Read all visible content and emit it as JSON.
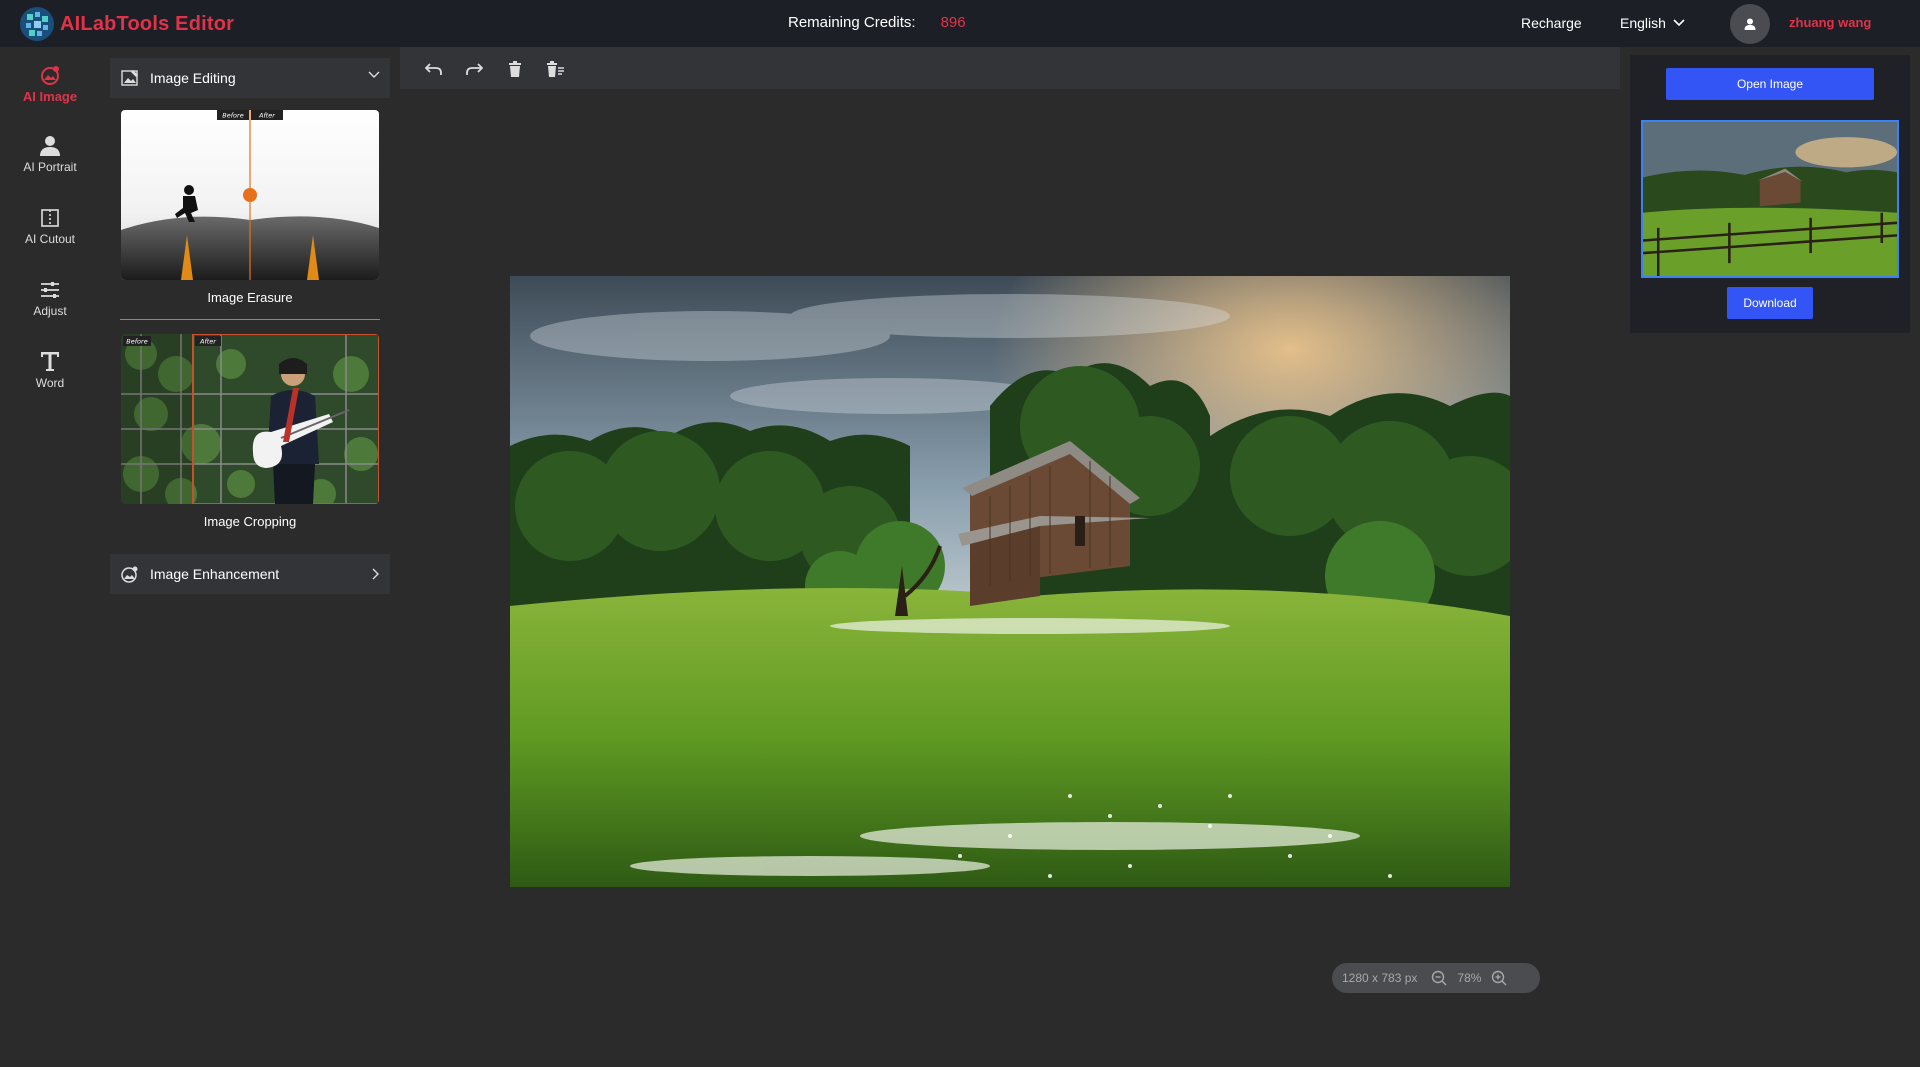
{
  "header": {
    "brand": "AILabTools Editor",
    "credits_label": "Remaining Credits:",
    "credits_value": "896",
    "recharge": "Recharge",
    "language": "English",
    "username": "zhuang wang"
  },
  "leftnav": {
    "items": [
      {
        "label": "AI Image",
        "icon": "ai-image-icon",
        "active": true
      },
      {
        "label": "AI Portrait",
        "icon": "portrait-icon"
      },
      {
        "label": "AI Cutout",
        "icon": "cutout-icon"
      },
      {
        "label": "Adjust",
        "icon": "sliders-icon"
      },
      {
        "label": "Word",
        "icon": "text-icon"
      }
    ]
  },
  "tools": {
    "section_editing": "Image Editing",
    "section_enhancement": "Image Enhancement",
    "erasure": {
      "label": "Image Erasure",
      "before": "Before",
      "after": "After"
    },
    "cropping": {
      "label": "Image Cropping",
      "before": "Before",
      "after": "After"
    }
  },
  "toolbar": {
    "icons": [
      "undo-icon",
      "redo-icon",
      "delete-icon",
      "clear-all-icon"
    ]
  },
  "canvas": {
    "dimensions": "1280 x 783 px",
    "zoom": "78%"
  },
  "rightpanel": {
    "open_label": "Open Image",
    "download_label": "Download"
  },
  "colors": {
    "accent_red": "#e0334a",
    "button_blue": "#3355f5",
    "header_bg": "#1c1f26"
  }
}
